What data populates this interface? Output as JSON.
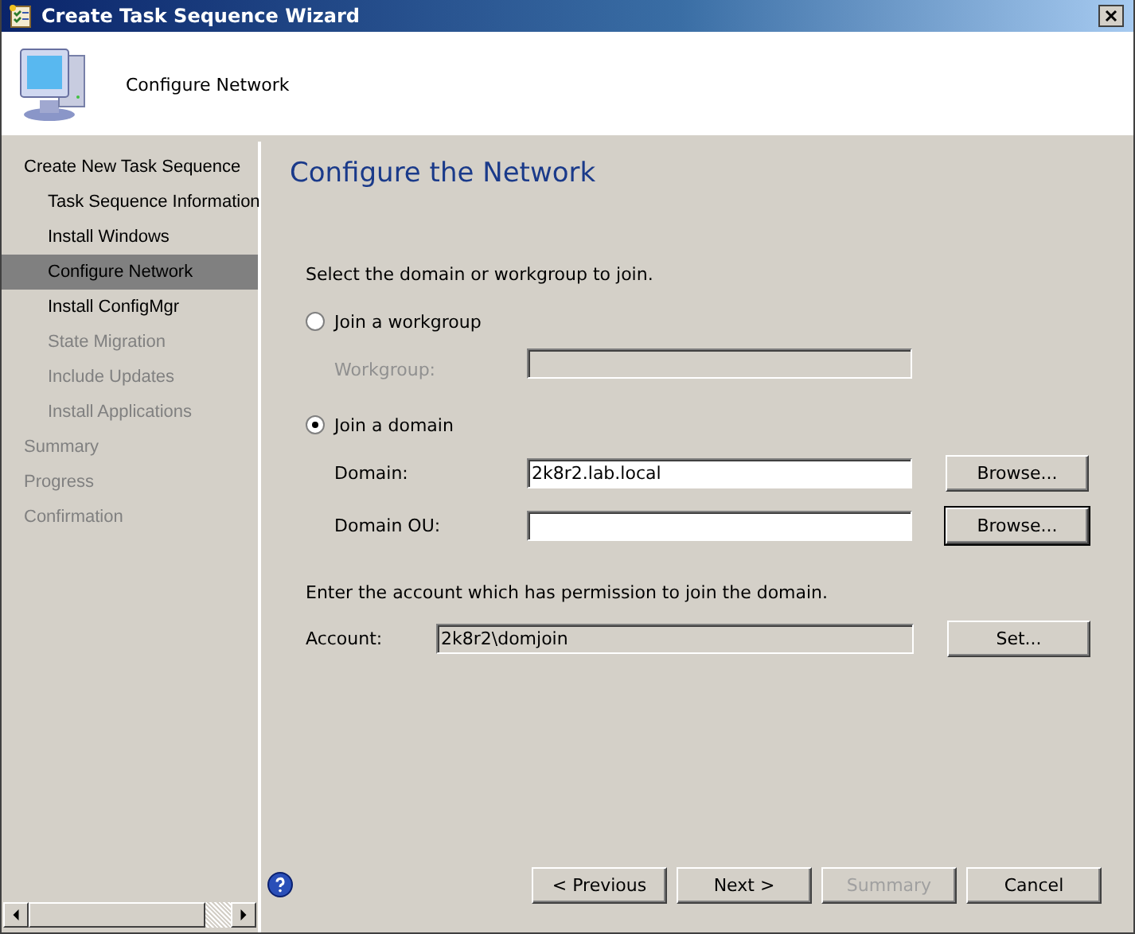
{
  "window": {
    "title": "Create Task Sequence Wizard"
  },
  "header": {
    "title": "Configure Network"
  },
  "sidebar": {
    "items": [
      {
        "label": "Create New Task Sequence",
        "selected": false,
        "disabled": false,
        "children": [
          {
            "label": "Task Sequence Information",
            "selected": false,
            "disabled": false
          },
          {
            "label": "Install Windows",
            "selected": false,
            "disabled": false
          },
          {
            "label": "Configure Network",
            "selected": true,
            "disabled": false
          },
          {
            "label": "Install ConfigMgr",
            "selected": false,
            "disabled": false
          },
          {
            "label": "State Migration",
            "selected": false,
            "disabled": true
          },
          {
            "label": "Include Updates",
            "selected": false,
            "disabled": true
          },
          {
            "label": "Install Applications",
            "selected": false,
            "disabled": true
          }
        ]
      },
      {
        "label": "Summary",
        "selected": false,
        "disabled": true
      },
      {
        "label": "Progress",
        "selected": false,
        "disabled": true
      },
      {
        "label": "Confirmation",
        "selected": false,
        "disabled": true
      }
    ]
  },
  "page": {
    "title": "Configure the Network",
    "prompt": "Select the domain or workgroup to join.",
    "choices": [
      {
        "label": "Join a workgroup",
        "selected": false,
        "fields": [
          {
            "label": "Workgroup:",
            "disabled": true
          }
        ]
      },
      {
        "label": "Join a domain",
        "selected": true,
        "fields": [
          {
            "label": "Domain:",
            "value": "2k8r2.lab.local",
            "disabled": false,
            "button": {
              "label": "Browse...",
              "focused": false
            }
          },
          {
            "label": "Domain OU:",
            "disabled": false,
            "button": {
              "label": "Browse...",
              "focused": true
            }
          }
        ]
      }
    ],
    "account": {
      "prompt": "Enter the account which has permission to join the domain.",
      "label": "Account:",
      "value": "2k8r2\\domjoin",
      "readonly": true,
      "button": {
        "label": "Set...",
        "focused": false
      }
    }
  },
  "footer": {
    "buttons": [
      {
        "label": "< Previous",
        "disabled": false
      },
      {
        "label": "Next >",
        "disabled": false
      },
      {
        "label": "Summary",
        "disabled": true
      },
      {
        "label": "Cancel",
        "disabled": false
      }
    ]
  }
}
